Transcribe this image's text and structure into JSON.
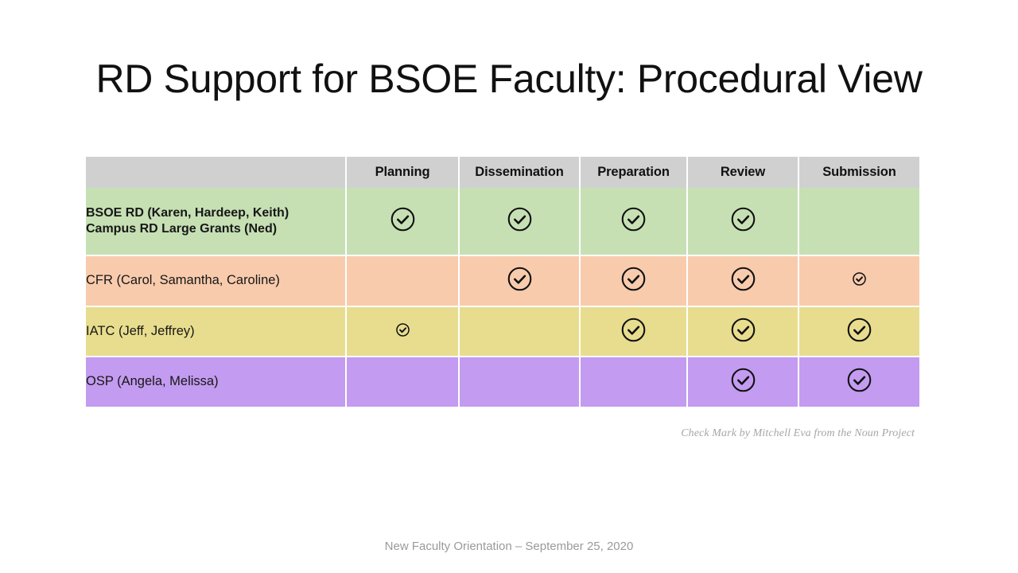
{
  "slide": {
    "title": "RD Support for BSOE Faculty: Procedural View",
    "attribution": "Check Mark by Mitchell Eva from the Noun Project",
    "footer": "New Faculty Orientation – September 25, 2020"
  },
  "colors": {
    "background": "#ffffff",
    "header_row": "#d0d0d0",
    "row_green": "#c6e0b4",
    "row_peach": "#f8cbad",
    "row_yellow": "#e8dd8e",
    "row_purple": "#c39bf0",
    "title_text": "#111111",
    "attribution_text": "#a6a6a6",
    "footer_text": "#9a9a9a",
    "check_stroke": "#111111"
  },
  "matrix": {
    "corner_header": "",
    "columns": [
      "Planning",
      "Dissemination",
      "Preparation",
      "Review",
      "Submission"
    ],
    "rows": [
      {
        "label": "BSOE RD (Karen, Hardeep, Keith)\nCampus RD Large Grants (Ned)",
        "label_line1": "BSOE RD (Karen, Hardeep, Keith)",
        "label_line2": "Campus RD Large Grants (Ned)",
        "bold": true,
        "color": "#c6e0b4",
        "marks": [
          "large",
          "large",
          "large",
          "large",
          "none"
        ]
      },
      {
        "label": "CFR (Carol, Samantha, Caroline)",
        "bold": false,
        "color": "#f8cbad",
        "marks": [
          "none",
          "large",
          "large",
          "large",
          "small"
        ]
      },
      {
        "label": "IATC (Jeff, Jeffrey)",
        "bold": false,
        "color": "#e8dd8e",
        "marks": [
          "small",
          "none",
          "large",
          "large",
          "large"
        ]
      },
      {
        "label": "OSP (Angela, Melissa)",
        "bold": false,
        "color": "#c39bf0",
        "marks": [
          "none",
          "none",
          "none",
          "large",
          "large"
        ]
      }
    ]
  },
  "icons": {
    "check_mark": "check-circle-icon"
  }
}
